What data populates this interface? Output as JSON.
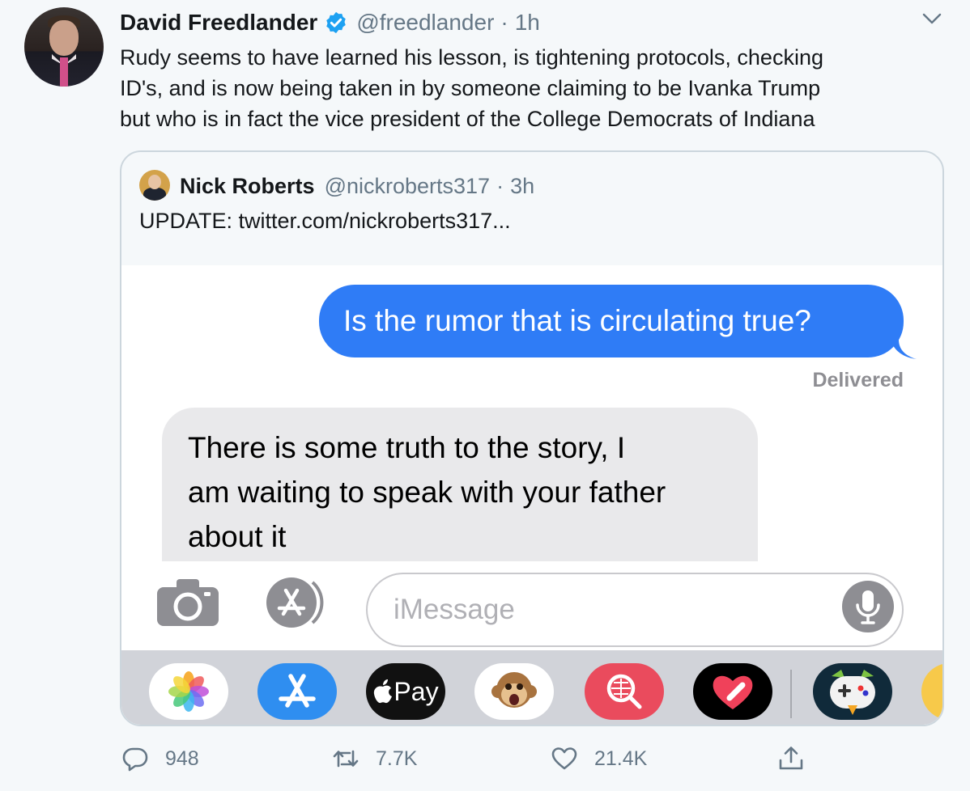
{
  "tweet": {
    "author_name": "David Freedlander",
    "handle": "@freedlander",
    "separator": "·",
    "time": "1h",
    "text_lines": [
      "Rudy seems to have learned his lesson, is tightening protocols, checking",
      "ID's, and is now being taken in by someone claiming to be Ivanka Trump",
      "but who is in fact the vice president of the College Democrats of Indiana"
    ]
  },
  "quote": {
    "author_name": "Nick Roberts",
    "handle": "@nickroberts317",
    "separator": "·",
    "time": "3h",
    "text": "UPDATE:  twitter.com/nickroberts317..."
  },
  "imessage": {
    "outgoing": "Is the rumor that is circulating true?",
    "status": "Delivered",
    "incoming_lines": [
      "There is some truth to the story, I",
      "am waiting to speak with your father",
      "about it"
    ],
    "input_placeholder": "iMessage",
    "pay_label": "Pay",
    "app_icons": [
      "photos-icon",
      "app-store-icon",
      "apple-pay-icon",
      "animoji-monkey-icon",
      "web-search-icon",
      "digital-touch-heart-icon",
      "game-bird-icon",
      "partial-app-icon"
    ]
  },
  "actions": {
    "replies": "948",
    "retweets": "7.7K",
    "likes": "21.4K"
  },
  "colors": {
    "verified": "#1da1f2",
    "imessage_blue": "#2f7cf6",
    "secondary_text": "#657786",
    "background": "#f5f8fa"
  }
}
